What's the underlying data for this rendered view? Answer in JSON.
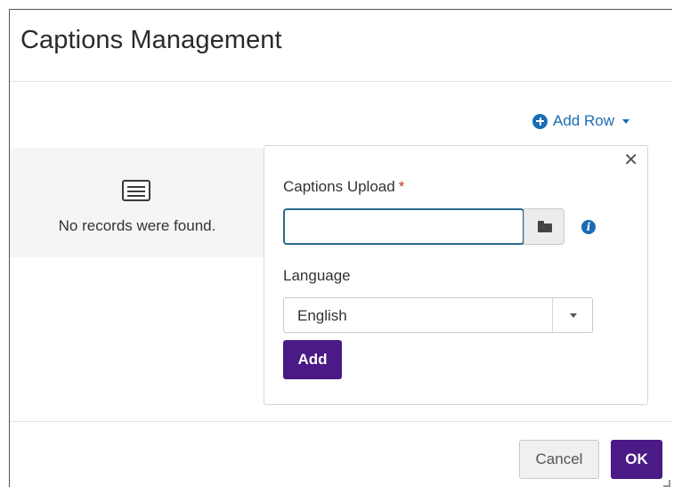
{
  "dialog": {
    "title": "Captions Management"
  },
  "toolbar": {
    "add_row_label": "Add Row"
  },
  "records": {
    "empty_message": "No records were found."
  },
  "upload_form": {
    "captions_label": "Captions Upload",
    "required_mark": "*",
    "captions_value": "",
    "info_glyph": "i",
    "language_label": "Language",
    "language_selected": "English",
    "add_label": "Add",
    "close_glyph": "✕"
  },
  "footer": {
    "cancel_label": "Cancel",
    "ok_label": "OK"
  },
  "colors": {
    "accent_purple": "#4a1a86",
    "link_blue": "#1a6bb5",
    "required_red": "#c0392b"
  },
  "icons": [
    "plus-circle-icon",
    "caret-down-icon",
    "list-icon",
    "close-icon",
    "folder-icon",
    "info-icon"
  ]
}
